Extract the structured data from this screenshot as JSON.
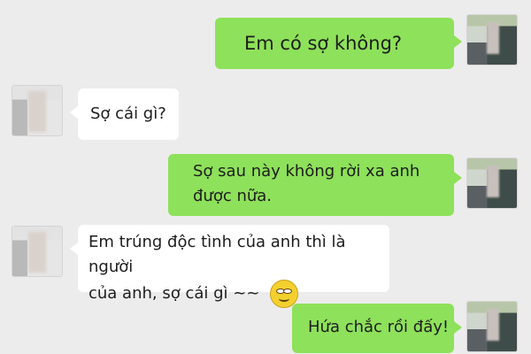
{
  "chat": {
    "messages": [
      {
        "side": "right",
        "text": "Em có sợ không?"
      },
      {
        "side": "left",
        "text": "Sợ cái gì?"
      },
      {
        "side": "right",
        "line1": "Sợ sau này không rời xa anh",
        "line2": "được nữa."
      },
      {
        "side": "left",
        "line1": "Em trúng độc tình của anh thì là người",
        "line2": "của anh, sợ cái gì ~~",
        "emoji": "smirk-emoji"
      },
      {
        "side": "right",
        "text": "Hứa chắc rồi đấy!"
      }
    ]
  },
  "colors": {
    "background": "#ececec",
    "sent_bubble": "#8ee15a",
    "received_bubble": "#ffffff"
  }
}
